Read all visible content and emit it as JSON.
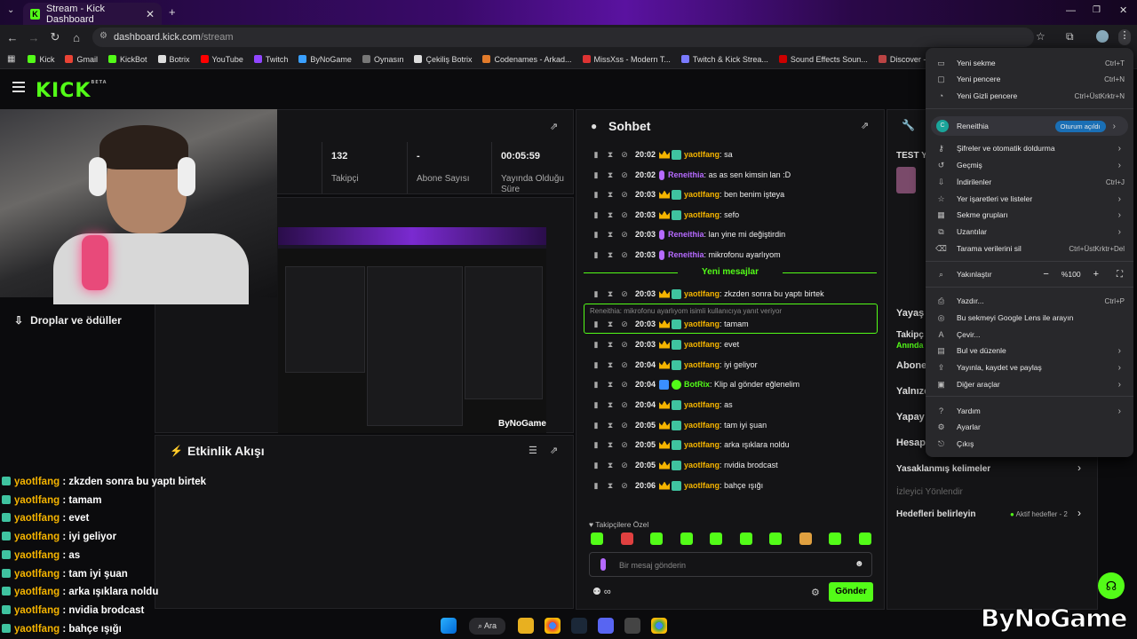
{
  "browser": {
    "tab_title": "Stream - Kick Dashboard",
    "url_host": "dashboard.kick.com",
    "url_path": "/stream",
    "bookmarks": [
      "Kick",
      "Gmail",
      "KickBot",
      "Botrix",
      "YouTube",
      "Twitch",
      "ByNoGame",
      "Oynasın",
      "Çekiliş Botrix",
      "Codenames - Arkad...",
      "MissXss - Modern T...",
      "Twitch & Kick Strea...",
      "Sound Effects Soun...",
      "Discover - Find Top..."
    ]
  },
  "kick": {
    "logo": "KICK",
    "logo_sup": "BETA",
    "stats": [
      {
        "value": "132",
        "label": "Takipçi"
      },
      {
        "value": "-",
        "label": "Abone Sayısı"
      },
      {
        "value": "00:05:59",
        "label": "Yayında Olduğu Süre"
      }
    ],
    "drops": "Droplar ve ödüller",
    "events_title": "Etkinlik Akışı",
    "chat_title": "Sohbet",
    "new_messages": "Yeni mesajlar",
    "reply_text": "Reneithia: mikrofonu ayarlıyom isimli kullanıcıya yanıt veriyor",
    "followers_only": "Takipçilere Özel",
    "input_placeholder": "Bir mesaj gönderin",
    "send_label": "Gönder"
  },
  "chat_messages": [
    {
      "time": "20:02",
      "user": "yaotlfang",
      "type": "sub",
      "text": "sa"
    },
    {
      "time": "20:02",
      "user": "Reneithia",
      "type": "mod",
      "text": "as as sen kimsin lan :D"
    },
    {
      "time": "20:03",
      "user": "yaotlfang",
      "type": "sub",
      "text": "ben benim işteya"
    },
    {
      "time": "20:03",
      "user": "yaotlfang",
      "type": "sub",
      "text": "sefo"
    },
    {
      "time": "20:03",
      "user": "Reneithia",
      "type": "mod",
      "text": "lan yine mi değiştirdin"
    },
    {
      "time": "20:03",
      "user": "Reneithia",
      "type": "mod",
      "text": "mikrofonu ayarlıyom"
    },
    {
      "time": "20:03",
      "user": "yaotlfang",
      "type": "sub",
      "text": "zkzden sonra bu yaptı birtek"
    },
    {
      "time": "20:03",
      "user": "yaotlfang",
      "type": "sub",
      "text": "tamam"
    },
    {
      "time": "20:03",
      "user": "yaotlfang",
      "type": "sub",
      "text": "evet"
    },
    {
      "time": "20:04",
      "user": "yaotlfang",
      "type": "sub",
      "text": "iyi geliyor"
    },
    {
      "time": "20:04",
      "user": "BotRix",
      "type": "bot",
      "text": "Klip al gönder eğlenelim"
    },
    {
      "time": "20:04",
      "user": "yaotlfang",
      "type": "sub",
      "text": "as"
    },
    {
      "time": "20:05",
      "user": "yaotlfang",
      "type": "sub",
      "text": "tam iyi şuan"
    },
    {
      "time": "20:05",
      "user": "yaotlfang",
      "type": "sub",
      "text": "arka ışıklara noldu"
    },
    {
      "time": "20:05",
      "user": "yaotlfang",
      "type": "sub",
      "text": "nvidia brodcast"
    },
    {
      "time": "20:06",
      "user": "yaotlfang",
      "type": "sub",
      "text": "bahçe ışığı"
    }
  ],
  "overlay_chat": [
    {
      "user": "yaotlfang",
      "text": "zkzden sonra bu yaptı birtek"
    },
    {
      "user": "yaotlfang",
      "text": "tamam"
    },
    {
      "user": "yaotlfang",
      "text": "evet"
    },
    {
      "user": "yaotlfang",
      "text": "iyi geliyor"
    },
    {
      "user": "yaotlfang",
      "text": "as"
    },
    {
      "user": "yaotlfang",
      "text": "tam iyi şuan"
    },
    {
      "user": "yaotlfang",
      "text": "arka ışıklara noldu"
    },
    {
      "user": "yaotlfang",
      "text": "nvidia brodcast"
    },
    {
      "user": "yaotlfang",
      "text": "bahçe ışığı"
    }
  ],
  "right_panel": {
    "title_stub": "TEST Y",
    "rows": [
      "Yayaş",
      "Takipç",
      "Anında",
      "Abone",
      "Yalnızc",
      "Yapay",
      "Hesap"
    ],
    "banned_words": "Yasaklanmış kelimeler",
    "viewer_redirect": "İzleyici Yönlendir",
    "set_goals": "Hedefleri belirleyin",
    "active_goals": "Aktif hedefler - 2"
  },
  "menu": {
    "new_tab": "Yeni sekme",
    "new_tab_sc": "Ctrl+T",
    "new_window": "Yeni pencere",
    "new_window_sc": "Ctrl+N",
    "incognito": "Yeni Gizli pencere",
    "incognito_sc": "Ctrl+ÜstKrktr+N",
    "profile": "Reneithia",
    "profile_status": "Oturum açıldı",
    "passwords": "Şifreler ve otomatik doldurma",
    "history": "Geçmiş",
    "downloads": "İndirilenler",
    "downloads_sc": "Ctrl+J",
    "bookmarks": "Yer işaretleri ve listeler",
    "tab_groups": "Sekme grupları",
    "extensions": "Uzantılar",
    "clear_data": "Tarama verilerini sil",
    "clear_data_sc": "Ctrl+ÜstKrktr+Del",
    "zoom": "Yakınlaştır",
    "zoom_value": "%100",
    "print": "Yazdır...",
    "print_sc": "Ctrl+P",
    "lens": "Bu sekmeyi Google Lens ile arayın",
    "translate": "Çevir...",
    "find": "Bul ve düzenle",
    "cast": "Yayınla, kaydet ve paylaş",
    "more_tools": "Diğer araçlar",
    "help": "Yardım",
    "settings": "Ayarlar",
    "exit": "Çıkış"
  },
  "taskbar": {
    "search": "Ara"
  },
  "watermark": "ByNoGame"
}
